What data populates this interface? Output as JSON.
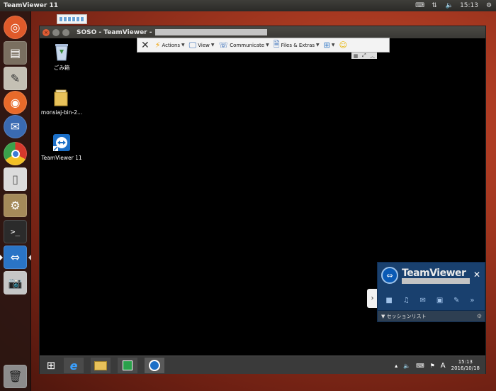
{
  "top_panel": {
    "app_title": "TeamViewer 11",
    "time": "15:13",
    "icons": [
      "keyboard-icon",
      "network-icon",
      "volume-icon",
      "settings-gear-icon"
    ]
  },
  "launcher": {
    "items": [
      {
        "name": "ubuntu-dash",
        "icon": "ubuntu-logo-icon",
        "color": "#e05a2a"
      },
      {
        "name": "files",
        "icon": "file-cabinet-icon",
        "color": "#7a6f60"
      },
      {
        "name": "text-editor",
        "icon": "text-editor-icon",
        "color": "#c4c0b4"
      },
      {
        "name": "firefox",
        "icon": "firefox-icon",
        "color": "#e86a2a"
      },
      {
        "name": "thunderbird",
        "icon": "thunderbird-icon",
        "color": "#3a6ab2"
      },
      {
        "name": "chrome",
        "icon": "chrome-icon",
        "color": "#d7392c"
      },
      {
        "name": "libreoffice",
        "icon": "document-icon",
        "color": "#dcdcdc"
      },
      {
        "name": "system-tools",
        "icon": "gear-tools-icon",
        "color": "#a58a5a"
      },
      {
        "name": "terminal",
        "icon": "terminal-icon",
        "color": "#2b2b2b"
      },
      {
        "name": "teamviewer",
        "icon": "teamviewer-icon",
        "color": "#2a74c6",
        "active": true
      },
      {
        "name": "camera",
        "icon": "camera-icon",
        "color": "#c6c6c6"
      },
      {
        "name": "trash",
        "icon": "trash-icon",
        "color": "#8c8c8c"
      }
    ]
  },
  "window": {
    "title": "SOSO - TeamViewer -"
  },
  "remote_toolbar": {
    "actions": "Actions",
    "view": "View",
    "communicate": "Communicate",
    "files": "Files & Extras"
  },
  "remote_desktop": {
    "icons": [
      {
        "label": "ごみ箱",
        "icon": "recycle-bin-icon"
      },
      {
        "label": "monsiaj-bin-2...",
        "icon": "folder-icon"
      },
      {
        "label": "TeamViewer 11",
        "icon": "teamviewer-shortcut-icon"
      }
    ]
  },
  "taskbar": {
    "ime": "A",
    "time": "15:13",
    "date": "2016/10/18"
  },
  "tv_panel": {
    "brand": "TeamViewer",
    "session_list": "▼ セッションリスト"
  },
  "colors": {
    "ubuntu_orange": "#e05a2a",
    "teamviewer_blue": "#19406e",
    "remote_bg": "#000000"
  }
}
